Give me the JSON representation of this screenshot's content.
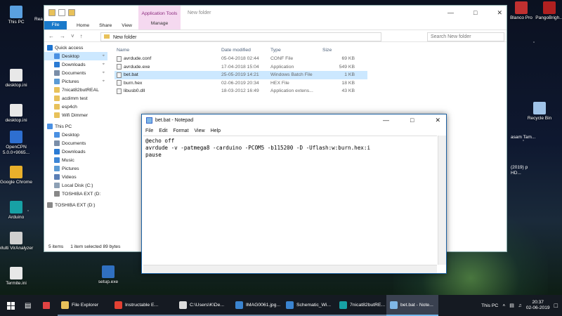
{
  "desktop": {
    "icons_left": [
      {
        "label": "This PC",
        "color": "#5aa0e0"
      },
      {
        "label": "desktop.ini",
        "color": "#e8e8e8"
      },
      {
        "label": "desktop.ini",
        "color": "#e8e8e8"
      },
      {
        "label": "OpenCPN 5.0.0+9065...",
        "color": "#2e6fd0"
      },
      {
        "label": "Google Chrome",
        "color": "#e9b02b"
      },
      {
        "label": "Arduino",
        "color": "#17a1a5"
      },
      {
        "label": "Multi VirAnalyzer",
        "color": "#d0d0d0"
      },
      {
        "label": "Termite.ini",
        "color": "#e8e8e8"
      }
    ],
    "icons_mid": [
      {
        "label": "Transmitter...",
        "color": "#1a9b4a"
      },
      {
        "label": "setup.exe",
        "color": "#3070c0"
      }
    ],
    "icons_right": [
      {
        "label": "Blanco Pro",
        "color": "#c03030"
      },
      {
        "label": "PangoBrigh...",
        "color": "#b02020"
      },
      {
        "label": "Recycle Bin",
        "color": "#9fc3e8"
      }
    ],
    "partial_texts": {
      "rea": "Rea",
      "asam": "asam Tam...",
      "hd": "(2019) p HD..."
    }
  },
  "explorer": {
    "context_tab": "Application Tools",
    "context_sub": "Manage",
    "window_title": "New folder",
    "ribbon_tabs": [
      "Home",
      "Share",
      "View"
    ],
    "file_tab": "File",
    "path": "New folder",
    "search_placeholder": "Search New folder",
    "nav": [
      {
        "label": "Quick access",
        "color": "#1f75d0",
        "indent": false
      },
      {
        "label": "Desktop",
        "color": "#4a90e2",
        "indent": true
      },
      {
        "label": "Downloads",
        "color": "#2b7bd4",
        "indent": true
      },
      {
        "label": "Documents",
        "color": "#7a8ea8",
        "indent": true
      },
      {
        "label": "Pictures",
        "color": "#5b9bd5",
        "indent": true
      },
      {
        "label": "7nicat82butREAL",
        "color": "#e8c15a",
        "indent": true
      },
      {
        "label": "acdimm test",
        "color": "#e8c15a",
        "indent": true
      },
      {
        "label": "esp4ch",
        "color": "#e8c15a",
        "indent": true
      },
      {
        "label": "Wifi Dimmer",
        "color": "#e8c15a",
        "indent": true
      },
      {
        "label": "This PC",
        "color": "#4a90e2",
        "indent": false
      },
      {
        "label": "Desktop",
        "color": "#4a90e2",
        "indent": true
      },
      {
        "label": "Documents",
        "color": "#7a8ea8",
        "indent": true
      },
      {
        "label": "Downloads",
        "color": "#2b7bd4",
        "indent": true
      },
      {
        "label": "Music",
        "color": "#3d86d6",
        "indent": true
      },
      {
        "label": "Pictures",
        "color": "#5b9bd5",
        "indent": true
      },
      {
        "label": "Videos",
        "color": "#5b7fb5",
        "indent": true
      },
      {
        "label": "Local Disk (C:)",
        "color": "#8da0b5",
        "indent": true
      },
      {
        "label": "TOSHIBA EXT (D:",
        "color": "#888888",
        "indent": true
      },
      {
        "label": "TOSHIBA EXT (D:)",
        "color": "#888888",
        "indent": false
      }
    ],
    "columns": [
      "Name",
      "Date modified",
      "Type",
      "Size"
    ],
    "files": [
      {
        "name": "avrdude.conf",
        "date": "05-04-2018 02:44",
        "type": "CONF File",
        "size": "69 KB",
        "selected": false
      },
      {
        "name": "avrdude.exe",
        "date": "17-04-2018 15:04",
        "type": "Application",
        "size": "549 KB",
        "selected": false
      },
      {
        "name": "bet.bat",
        "date": "25-05-2019 14:21",
        "type": "Windows Batch File",
        "size": "1 KB",
        "selected": true
      },
      {
        "name": "burn.hex",
        "date": "02-06-2019 20:34",
        "type": "HEX File",
        "size": "18 KB",
        "selected": false
      },
      {
        "name": "libusb0.dll",
        "date": "18-03-2012 16:49",
        "type": "Application extens...",
        "size": "43 KB",
        "selected": false
      }
    ],
    "status": {
      "count": "5 items",
      "selection": "1 item selected  89 bytes"
    }
  },
  "notepad": {
    "title": "bet.bat - Notepad",
    "menu": [
      "File",
      "Edit",
      "Format",
      "View",
      "Help"
    ],
    "content": "@echo off\navrdude -v -patmega8 -carduino -PCOM5 -b115200 -D -Uflash:w:burn.hex:i\npause"
  },
  "taskbar": {
    "buttons": [
      {
        "label": "File Explorer",
        "color": "#e8c15a",
        "state": "open"
      },
      {
        "label": "Instructable E...",
        "color": "#e34133",
        "state": "open"
      },
      {
        "label": "C:\\Users\\K\\De...",
        "color": "#dddddd",
        "state": "open"
      },
      {
        "label": "IMAG0061.jpg...",
        "color": "#3a84d0",
        "state": "open"
      },
      {
        "label": "Schematic_Wi...",
        "color": "#3a84d0",
        "state": "open"
      },
      {
        "label": "7nicat82butRE...",
        "color": "#17a1a5",
        "state": "open"
      },
      {
        "label": "bet.bat - Note...",
        "color": "#7fb7e6",
        "state": "active"
      }
    ],
    "tray_label": "This PC",
    "time": "20:37",
    "date": "02-06-2019"
  }
}
